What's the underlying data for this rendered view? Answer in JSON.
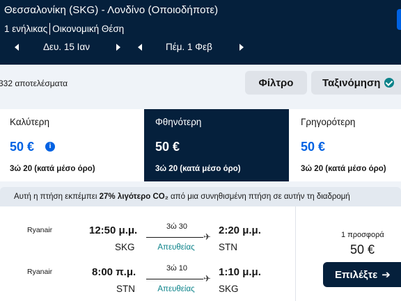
{
  "header": {
    "route": "Θεσσαλονίκη (SKG) - Λονδίνο (Οποιοδήποτε)",
    "passengers": "1 ενήλικας",
    "cabin": "Οικονομική Θέση",
    "outbound_date": "Δευ. 15 Ιαν",
    "return_date": "Πέμ. 1 Φεβ"
  },
  "results": {
    "count": "332 αποτελέσματα",
    "filter_label": "Φίλτρο",
    "sort_label": "Ταξινόμηση"
  },
  "tabs": [
    {
      "label": "Καλύτερη",
      "price": "50 €",
      "duration": "3ώ 20 (κατά μέσο όρο)",
      "active": false
    },
    {
      "label": "Φθηνότερη",
      "price": "50 €",
      "duration": "3ώ 20 (κατά μέσο όρο)",
      "active": true
    },
    {
      "label": "Γρηγορότερη",
      "price": "50 €",
      "duration": "3ώ 20 (κατά μέσο όρο)",
      "active": false
    }
  ],
  "eco": {
    "prefix": "Αυτή η πτήση εκπέμπει",
    "highlight": "27% λιγότερο CO₂",
    "suffix": "από μια συνηθισμένη πτήση σε αυτήν τη διαδρομή"
  },
  "card": {
    "legs": [
      {
        "airline": "Ryanair",
        "depart_time": "12:50 μ.μ.",
        "depart_code": "SKG",
        "duration": "3ώ 30",
        "stops": "Απευθείας",
        "arrive_time": "2:20 μ.μ.",
        "arrive_code": "STN"
      },
      {
        "airline": "Ryanair",
        "depart_time": "8:00 π.μ.",
        "depart_code": "STN",
        "duration": "3ώ 10",
        "stops": "Απευθείας",
        "arrive_time": "1:10 μ.μ.",
        "arrive_code": "SKG"
      }
    ],
    "offers": "1 προσφορά",
    "price": "50 €",
    "select_label": "Επιλέξτε"
  },
  "colors": {
    "header_bg": "#05203c",
    "accent_blue": "#0062e3",
    "teal": "#0c838a"
  }
}
